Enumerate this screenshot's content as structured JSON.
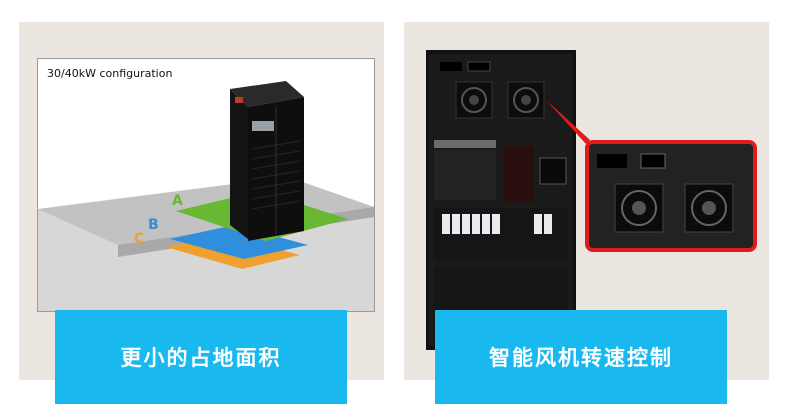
{
  "left_panel": {
    "configuration_label": "30/40kW configuration",
    "footprint_letters": [
      "A",
      "B",
      "C"
    ],
    "banner_text": "更小的占地面积"
  },
  "right_panel": {
    "banner_text": "智能风机转速控制"
  },
  "colors": {
    "panel_background": "#ebe6df",
    "banner_background": "#19b9ef",
    "footprint_a": "#69b833",
    "footprint_b": "#2f8fdc",
    "footprint_c": "#f0a030",
    "highlight_border": "#e11a1a"
  }
}
